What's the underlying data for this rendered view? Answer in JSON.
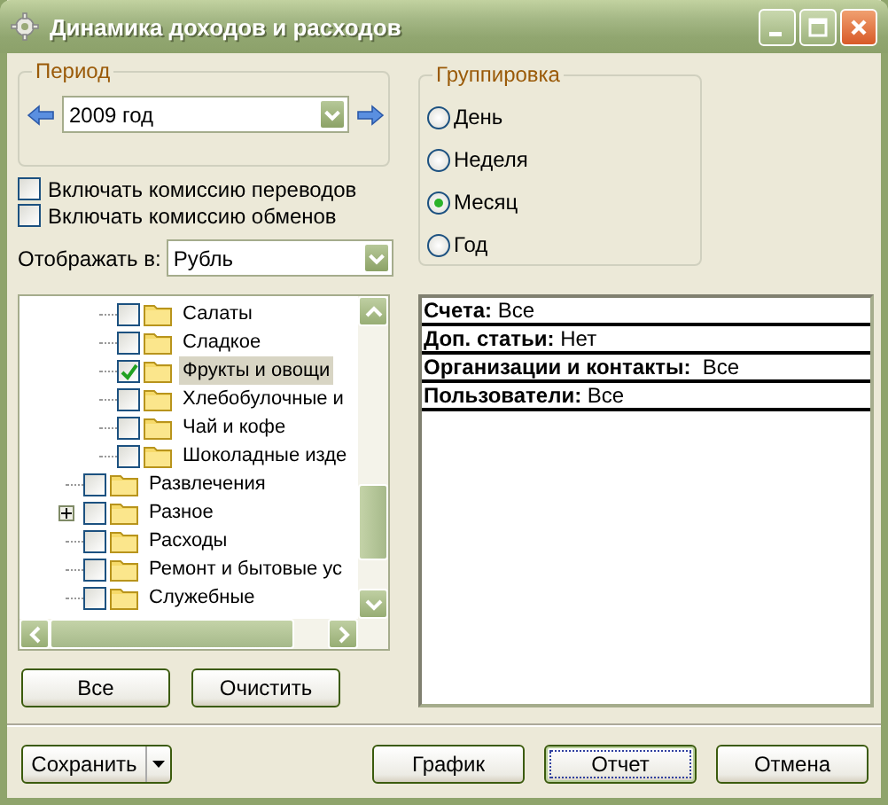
{
  "window": {
    "title": "Динамика доходов и расходов"
  },
  "period": {
    "legend": "Период",
    "value": "2009 год"
  },
  "options": [
    {
      "label": "Включать комиссию переводов",
      "checked": false
    },
    {
      "label": "Включать комиссию обменов",
      "checked": false
    }
  ],
  "display_currency": {
    "label": "Отображать в:",
    "value": "Рубль"
  },
  "grouping": {
    "legend": "Группировка",
    "options": [
      {
        "label": "День",
        "selected": false
      },
      {
        "label": "Неделя",
        "selected": false
      },
      {
        "label": "Месяц",
        "selected": true
      },
      {
        "label": "Год",
        "selected": false
      }
    ]
  },
  "tree": {
    "items": [
      {
        "children": [
          {
            "label": "Салаты",
            "checked": false,
            "selected": false,
            "expandable": false
          },
          {
            "label": "Сладкое",
            "checked": false,
            "selected": false,
            "expandable": false
          },
          {
            "label": "Фрукты и овощи",
            "checked": true,
            "selected": true,
            "expandable": false
          },
          {
            "label": "Хлебобулочные и",
            "checked": false,
            "selected": false,
            "expandable": false
          },
          {
            "label": "Чай и кофе",
            "checked": false,
            "selected": false,
            "expandable": false
          },
          {
            "label": "Шоколадные изде",
            "checked": false,
            "selected": false,
            "expandable": false
          }
        ]
      },
      {
        "label": "Развлечения",
        "checked": false,
        "selected": false,
        "expandable": false
      },
      {
        "label": "Разное",
        "checked": false,
        "selected": false,
        "expandable": true
      },
      {
        "label": "Расходы",
        "checked": false,
        "selected": false,
        "expandable": false
      },
      {
        "label": "Ремонт и бытовые ус",
        "checked": false,
        "selected": false,
        "expandable": false
      },
      {
        "label": "Служебные",
        "checked": false,
        "selected": false,
        "expandable": false
      }
    ]
  },
  "tree_buttons": [
    "Все",
    "Очистить"
  ],
  "summary": [
    "**Счета:** Все",
    "**Доп. статьи:** Нет",
    "**Организации и контакты:**  Все",
    "**Пользователи:** Все"
  ],
  "footer": {
    "save_button": "Сохранить",
    "buttons": [
      {
        "label": "График",
        "focused": false
      },
      {
        "label": "Отчет",
        "focused": true
      },
      {
        "label": "Отмена",
        "focused": false
      }
    ]
  }
}
